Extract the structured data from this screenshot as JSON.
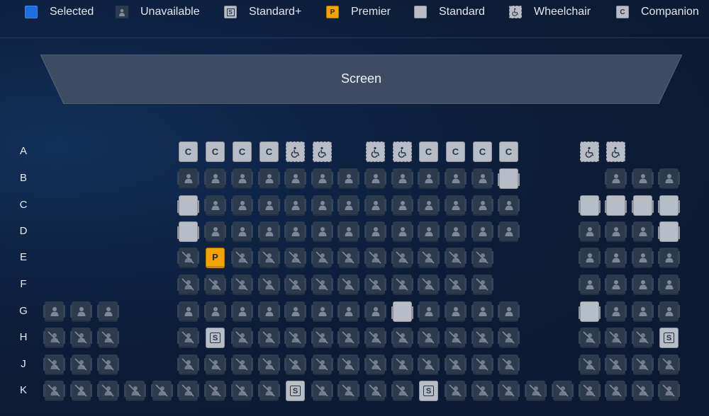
{
  "legend": [
    {
      "type": "selected",
      "label": "Selected",
      "color": "#1d6fe0",
      "icon": "selected-swatch"
    },
    {
      "type": "unavailable",
      "label": "Unavailable",
      "color": "#2c3a4e",
      "icon": "person-icon"
    },
    {
      "type": "standard_plus",
      "label": "Standard+",
      "color": "#b7bdc6",
      "icon": "S",
      "badge": "S"
    },
    {
      "type": "premier",
      "label": "Premier",
      "color": "#f5a300",
      "icon": "P",
      "badge": "P"
    },
    {
      "type": "standard",
      "label": "Standard",
      "color": "#b7bdc6",
      "icon": "standard-swatch"
    },
    {
      "type": "wheelchair",
      "label": "Wheelchair",
      "color": "#b7bdc6",
      "icon": "wheelchair-icon"
    },
    {
      "type": "companion",
      "label": "Companion",
      "color": "#b7bdc6",
      "icon": "C",
      "badge": "C"
    }
  ],
  "screen": {
    "label": "Screen"
  },
  "seat_codes": {
    "U": "unavailable",
    "X": "unavailable-struck",
    "s": "standard",
    "c": "companion",
    "w": "wheelchair",
    "S": "standard-plus",
    "P": "premier",
    "_": "empty"
  },
  "rows": [
    {
      "label": "A",
      "seats": "_____cccc_ww__w_wcccc___ww__"
    },
    {
      "label": "B",
      "seats": "_____UUUUUUUUUUUUss___UUUU"
    },
    {
      "label": "C",
      "seats": "_____sUUUUUUUUUUUU___ssss"
    },
    {
      "label": "D",
      "seats": "_____sUUUUUUUUUUUU___UUUs"
    },
    {
      "label": "E",
      "seats": "_____XPXXXXXXXXXX____UUUU"
    },
    {
      "label": "F",
      "seats": "_____XXXXXXXXXXXX____UUUU"
    },
    {
      "label": "G",
      "seats": "UUU__UUUUUUUUsUUUU___sUUU"
    },
    {
      "label": "H",
      "seats": "XXX__XSXXXXXXXXXXX___XXXS"
    },
    {
      "label": "J",
      "seats": "XXX__XXXXXXXXXXXXX___XXXX"
    },
    {
      "label": "K",
      "seats": "XXXXXXXXXSXXXXSXXXXXXXXXX"
    }
  ]
}
